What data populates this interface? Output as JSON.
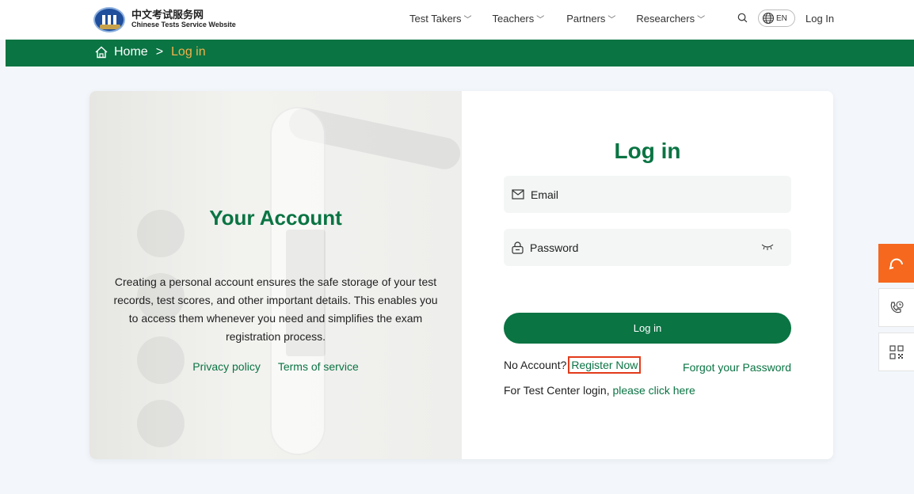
{
  "header": {
    "logo_cn": "中文考试服务网",
    "logo_en": "Chinese Tests Service Website",
    "nav": [
      "Test Takers",
      "Teachers",
      "Partners",
      "Researchers"
    ],
    "lang": "EN",
    "login": "Log In"
  },
  "breadcrumb": {
    "home": "Home",
    "separator": ">",
    "current": "Log in"
  },
  "account_panel": {
    "title": "Your Account",
    "description": "Creating a personal account ensures the safe storage of your test records, test scores, and other important details. This enables you to access them whenever you need and simplifies the exam registration process.",
    "privacy": "Privacy policy",
    "terms": "Terms of service"
  },
  "login_form": {
    "title": "Log in",
    "email_placeholder": "Email",
    "password_placeholder": "Password",
    "submit": "Log in",
    "no_account": "No Account?",
    "register": "Register Now",
    "forgot": "Forgot your Password",
    "test_center_prefix": "For Test Center login,",
    "test_center_link": "please click here"
  },
  "colors": {
    "brand_green": "#0a7443",
    "breadcrumb_current": "#f2b14a",
    "support_orange": "#f6681d",
    "highlight_red": "#e23b1a"
  },
  "icons": [
    "home-icon",
    "search-icon",
    "globe-icon",
    "mail-icon",
    "lock-icon",
    "eye-closed-icon",
    "headset-icon",
    "phone-clock-icon",
    "qr-code-icon",
    "chevron-down-icon"
  ]
}
